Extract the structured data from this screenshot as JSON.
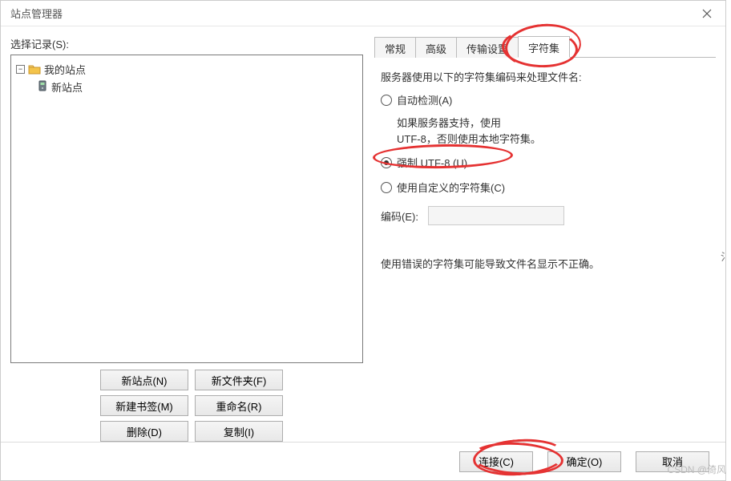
{
  "title": "站点管理器",
  "leftLabel": "选择记录(S):",
  "tree": {
    "root": "我的站点",
    "child": "新站点"
  },
  "leftButtons": {
    "newSite": "新站点(N)",
    "newFolder": "新文件夹(F)",
    "newBookmark": "新建书签(M)",
    "rename": "重命名(R)",
    "delete": "删除(D)",
    "copy": "复制(I)"
  },
  "tabs": {
    "general": "常规",
    "advanced": "高级",
    "transfer": "传输设置",
    "charset": "字符集"
  },
  "content": {
    "heading": "服务器使用以下的字符集编码来处理文件名:",
    "autoDetect": "自动检测(A)",
    "hint1": "如果服务器支持，使用",
    "hint2": "UTF-8，否则使用本地字符集。",
    "forceUtf8": "强制 UTF-8 (U)",
    "custom": "使用自定义的字符集(C)",
    "encLabel": "编码(E):",
    "warning": "使用错误的字符集可能导致文件名显示不正确。"
  },
  "footer": {
    "connect": "连接(C)",
    "ok": "确定(O)",
    "cancel": "取消"
  },
  "watermark": "CSDN @倚风"
}
